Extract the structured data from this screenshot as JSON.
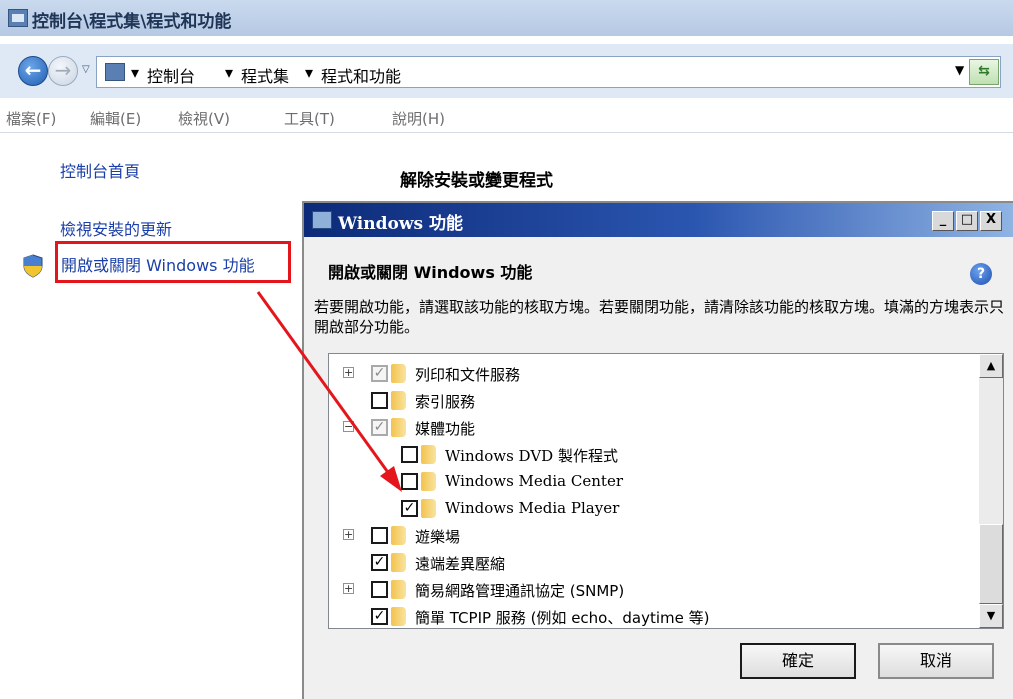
{
  "window": {
    "title": "控制台\\程式集\\程式和功能"
  },
  "address": {
    "crumbs": [
      "控制台",
      "程式集",
      "程式和功能"
    ],
    "separator": "▸"
  },
  "menu": [
    "檔案(F)",
    "編輯(E)",
    "檢視(V)",
    "工具(T)",
    "說明(H)"
  ],
  "sidebar": {
    "home": "控制台首頁",
    "updates": "檢視安裝的更新",
    "features": "開啟或關閉 Windows 功能"
  },
  "main": {
    "heading": "解除安裝或變更程式"
  },
  "dialog": {
    "title": "Windows 功能",
    "heading": "開啟或關閉 Windows 功能",
    "description": "若要開啟功能，請選取該功能的核取方塊。若要關閉功能，請清除該功能的核取方塊。填滿的方塊表示只開啟部分功能。",
    "items": [
      {
        "label": "列印和文件服務",
        "state": "partial",
        "expander": "+",
        "indent": 0
      },
      {
        "label": "索引服務",
        "state": "unchecked",
        "expander": "",
        "indent": 0
      },
      {
        "label": "媒體功能",
        "state": "partial",
        "expander": "−",
        "indent": 0
      },
      {
        "label": "Windows DVD 製作程式",
        "state": "unchecked",
        "expander": "",
        "indent": 1
      },
      {
        "label": "Windows Media Center",
        "state": "unchecked",
        "expander": "",
        "indent": 1
      },
      {
        "label": "Windows Media Player",
        "state": "checked",
        "expander": "",
        "indent": 1
      },
      {
        "label": "遊樂場",
        "state": "unchecked",
        "expander": "+",
        "indent": 0
      },
      {
        "label": "遠端差異壓縮",
        "state": "checked",
        "expander": "",
        "indent": 0
      },
      {
        "label": "簡易網路管理通訊協定 (SNMP)",
        "state": "unchecked",
        "expander": "+",
        "indent": 0
      },
      {
        "label": "簡單 TCPIP 服務 (例如 echo、daytime 等)",
        "state": "checked",
        "expander": "",
        "indent": 0
      }
    ],
    "ok_label": "確定",
    "cancel_label": "取消",
    "caption_buttons": [
      "_",
      "□",
      "X"
    ]
  },
  "icons": {
    "back": "back-arrow-icon",
    "forward": "forward-arrow-icon",
    "shield": "uac-shield-icon",
    "help": "help-icon",
    "folder": "folder-icon"
  },
  "colors": {
    "highlight_box": "#e4161c",
    "link": "#1a3fa8",
    "dialog_title": "#0c2a78"
  }
}
